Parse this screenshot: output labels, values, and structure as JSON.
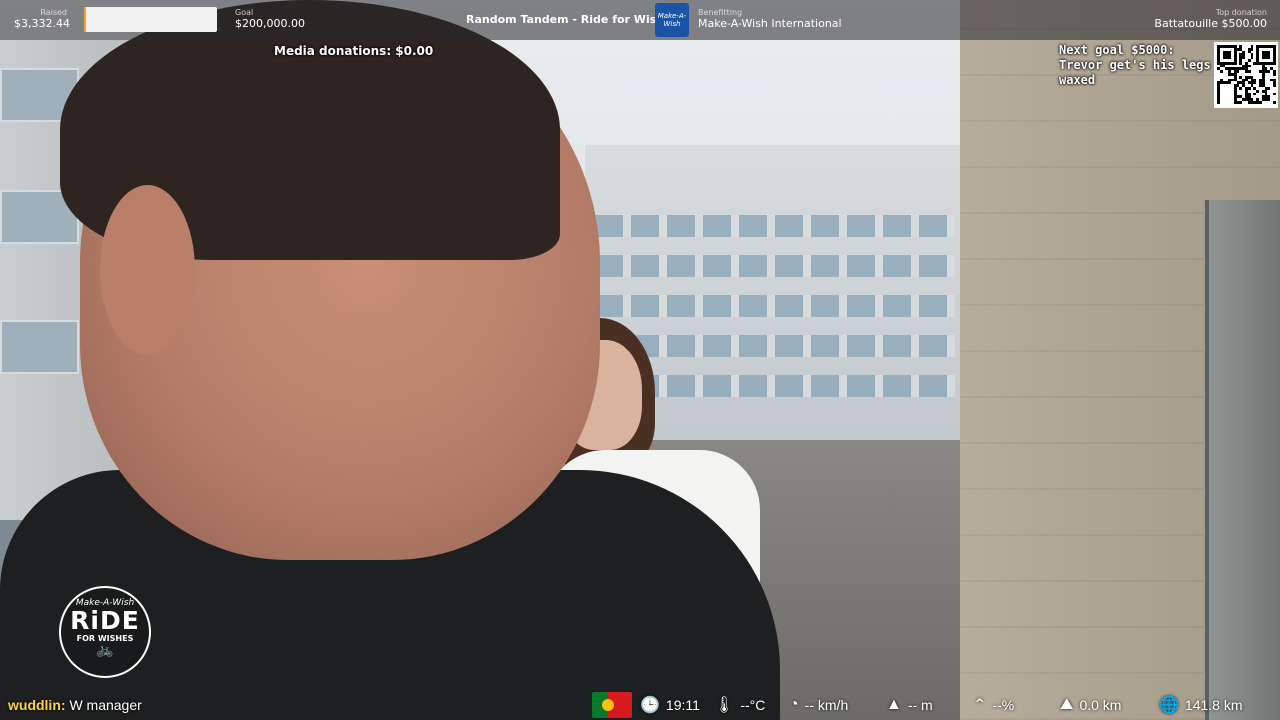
{
  "topbar": {
    "raised_label": "Raised",
    "raised_value": "$3,332.44",
    "progress_fraction": 0.0167,
    "goal_label": "Goal",
    "goal_value": "$200,000.00",
    "event_title": "Random Tandem - Ride for Wishes",
    "charity_logo_text": "Make-A-Wish",
    "benefiting_label": "Benefitting",
    "benefiting_value": "Make-A-Wish International",
    "top_donation_label": "Top donation",
    "top_donation_value": "Battatouille $500.00"
  },
  "overlay": {
    "media_donations": "Media donations: $0.00",
    "next_goal": "Next goal $5000: Trevor get's his legs waxed"
  },
  "badge": {
    "line1": "Make-A-Wish",
    "line2": "RiDE",
    "line3": "FOR WISHES",
    "icon": "bicycle-icon"
  },
  "chat": {
    "username": "wuddlin:",
    "message": "W manager"
  },
  "status": {
    "country_flag": "portugal-flag-icon",
    "time": "19:11",
    "temperature": "--°C",
    "speed": "-- km/h",
    "altitude": "-- m",
    "incline": "--%",
    "distance_today": "0.0 km",
    "distance_total": "141.8 km"
  },
  "colors": {
    "progress_fill": "#f2a12d",
    "progress_track": "#f2f2f2",
    "charity_blue": "#1b54a6",
    "chat_username": "#ffd24a"
  }
}
